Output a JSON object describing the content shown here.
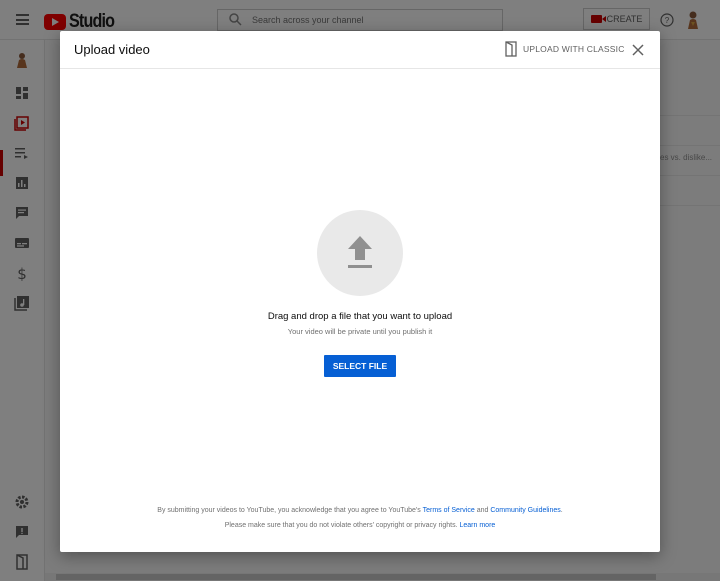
{
  "app": {
    "logo_text": "Studio",
    "search_placeholder": "Search across your channel",
    "create_label": "CREATE"
  },
  "background": {
    "partial_text": "es vs. dislike..."
  },
  "sidebar": {
    "items": [
      {
        "icon": "channel-avatar-icon"
      },
      {
        "icon": "dashboard-icon"
      },
      {
        "icon": "videos-icon",
        "active": true
      },
      {
        "icon": "playlists-icon"
      },
      {
        "icon": "analytics-icon"
      },
      {
        "icon": "comments-icon"
      },
      {
        "icon": "subtitles-icon"
      },
      {
        "icon": "monetization-icon"
      },
      {
        "icon": "audio-library-icon"
      },
      {
        "icon": "settings-icon"
      },
      {
        "icon": "feedback-icon"
      },
      {
        "icon": "creator-studio-classic-icon"
      }
    ]
  },
  "dialog": {
    "title": "Upload video",
    "classic_label": "UPLOAD WITH CLASSIC",
    "drag_text": "Drag and drop a file that you want to upload",
    "private_text": "Your video will be private until you publish it",
    "select_label": "SELECT FILE",
    "footer": {
      "line1_prefix": "By submitting your videos to YouTube, you acknowledge that you agree to YouTube's",
      "terms_link": "Terms of Service",
      "and_word": "and",
      "guidelines_link": "Community Guidelines",
      "line1_suffix": ".",
      "line2_prefix": "Please make sure that you do not violate others' copyright or privacy rights.",
      "learn_more": "Learn more"
    }
  },
  "colors": {
    "brand_red": "#ff0000",
    "accent_blue": "#065fd4",
    "overlay": "rgba(0,0,0,0.5)"
  }
}
